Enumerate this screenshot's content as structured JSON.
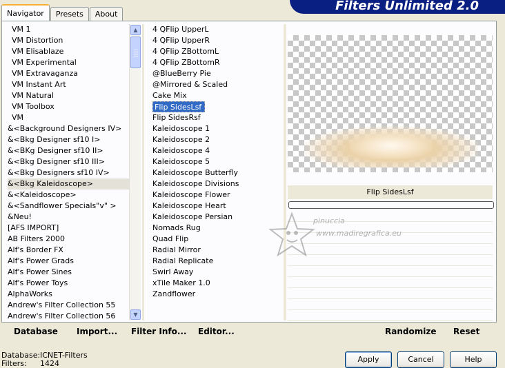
{
  "tabs": [
    "Navigator",
    "Presets",
    "About"
  ],
  "title": "Filters Unlimited 2.0",
  "categories": [
    {
      "label": "VM 1",
      "vm": true
    },
    {
      "label": "VM Distortion",
      "vm": true
    },
    {
      "label": "VM Elisablaze",
      "vm": true
    },
    {
      "label": "VM Experimental",
      "vm": true
    },
    {
      "label": "VM Extravaganza",
      "vm": true
    },
    {
      "label": "VM Instant Art",
      "vm": true
    },
    {
      "label": "VM Natural",
      "vm": true
    },
    {
      "label": "VM Toolbox",
      "vm": true
    },
    {
      "label": "VM",
      "vm": true
    },
    {
      "label": "&<Background Designers IV>"
    },
    {
      "label": "&<Bkg Designer sf10 I>"
    },
    {
      "label": "&<BKg Designer sf10 II>"
    },
    {
      "label": "&<Bkg Designer sf10 III>"
    },
    {
      "label": "&<Bkg Designers sf10 IV>"
    },
    {
      "label": "&<Bkg Kaleidoscope>",
      "selected": true
    },
    {
      "label": "&<Kaleidoscope>"
    },
    {
      "label": "&<Sandflower Specials\"v\" >"
    },
    {
      "label": "&Neu!"
    },
    {
      "label": "[AFS IMPORT]"
    },
    {
      "label": "AB Filters 2000"
    },
    {
      "label": "Alf's Border FX"
    },
    {
      "label": "Alf's Power Grads"
    },
    {
      "label": "Alf's Power Sines"
    },
    {
      "label": "Alf's Power Toys"
    },
    {
      "label": "AlphaWorks"
    },
    {
      "label": "Andrew's Filter Collection 55"
    },
    {
      "label": "Andrew's Filter Collection 56"
    }
  ],
  "filters": [
    {
      "label": "4 QFlip UpperL"
    },
    {
      "label": "4 QFlip UpperR"
    },
    {
      "label": "4 QFlip ZBottomL"
    },
    {
      "label": "4 QFlip ZBottomR"
    },
    {
      "label": "@BlueBerry Pie"
    },
    {
      "label": "@Mirrored & Scaled"
    },
    {
      "label": "Cake Mix"
    },
    {
      "label": "Flip SidesLsf",
      "selected": true
    },
    {
      "label": "Flip SidesRsf"
    },
    {
      "label": "Kaleidoscope 1"
    },
    {
      "label": "Kaleidoscope 2"
    },
    {
      "label": "Kaleidoscope 4"
    },
    {
      "label": "Kaleidoscope 5"
    },
    {
      "label": "Kaleidoscope Butterfly"
    },
    {
      "label": "Kaleidoscope Divisions"
    },
    {
      "label": "Kaleidoscope Flower"
    },
    {
      "label": "Kaleidoscope Heart"
    },
    {
      "label": "Kaleidoscope Persian"
    },
    {
      "label": "Nomads Rug"
    },
    {
      "label": "Quad Flip"
    },
    {
      "label": "Radial Mirror"
    },
    {
      "label": "Radial Replicate"
    },
    {
      "label": "Swirl Away"
    },
    {
      "label": "xTile Maker 1.0"
    },
    {
      "label": "Zandflower"
    }
  ],
  "preview": {
    "filter_name": "Flip SidesLsf"
  },
  "watermark": {
    "line1": "pinuccia",
    "line2": "www.madiregrafica.eu"
  },
  "toolbar": {
    "database": "Database",
    "import": "Import...",
    "filter_info": "Filter Info...",
    "editor": "Editor...",
    "randomize": "Randomize",
    "reset": "Reset"
  },
  "status": {
    "database_label": "Database:",
    "database_value": "ICNET-Filters",
    "filters_label": "Filters:",
    "filters_value": "1424"
  },
  "buttons": {
    "apply": "Apply",
    "cancel": "Cancel",
    "help": "Help"
  }
}
